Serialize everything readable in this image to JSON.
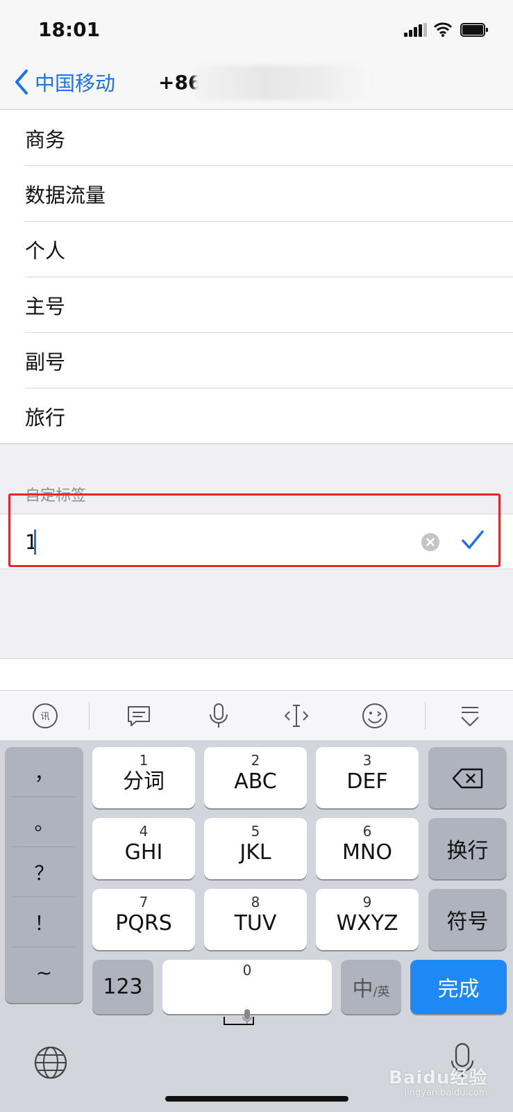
{
  "status_bar": {
    "time": "18:01"
  },
  "nav": {
    "back_label": "中国移动",
    "title": "+86"
  },
  "labels": {
    "items": [
      "商务",
      "数据流量",
      "个人",
      "主号",
      "副号",
      "旅行"
    ]
  },
  "custom_section": {
    "header": "自定标签",
    "input_value": "1"
  },
  "keyboard": {
    "punctuation": [
      "，",
      "。",
      "？",
      "！",
      "~"
    ],
    "keys": [
      {
        "num": "1",
        "letters": "分词"
      },
      {
        "num": "2",
        "letters": "ABC"
      },
      {
        "num": "3",
        "letters": "DEF"
      },
      {
        "num": "4",
        "letters": "GHI"
      },
      {
        "num": "5",
        "letters": "JKL"
      },
      {
        "num": "6",
        "letters": "MNO"
      },
      {
        "num": "7",
        "letters": "PQRS"
      },
      {
        "num": "8",
        "letters": "TUV"
      },
      {
        "num": "9",
        "letters": "WXYZ"
      }
    ],
    "newline_label": "换行",
    "symbols_label": "符号",
    "numbers_label": "123",
    "space_num": "0",
    "lang_main": "中",
    "lang_sub": "/英",
    "done_label": "完成"
  },
  "watermark": {
    "main": "Baidu经验",
    "sub": "jingyan.baidu.com"
  },
  "colors": {
    "accent": "#1a73e8",
    "done_key": "#1e88f5",
    "highlight": "#e5262b"
  }
}
